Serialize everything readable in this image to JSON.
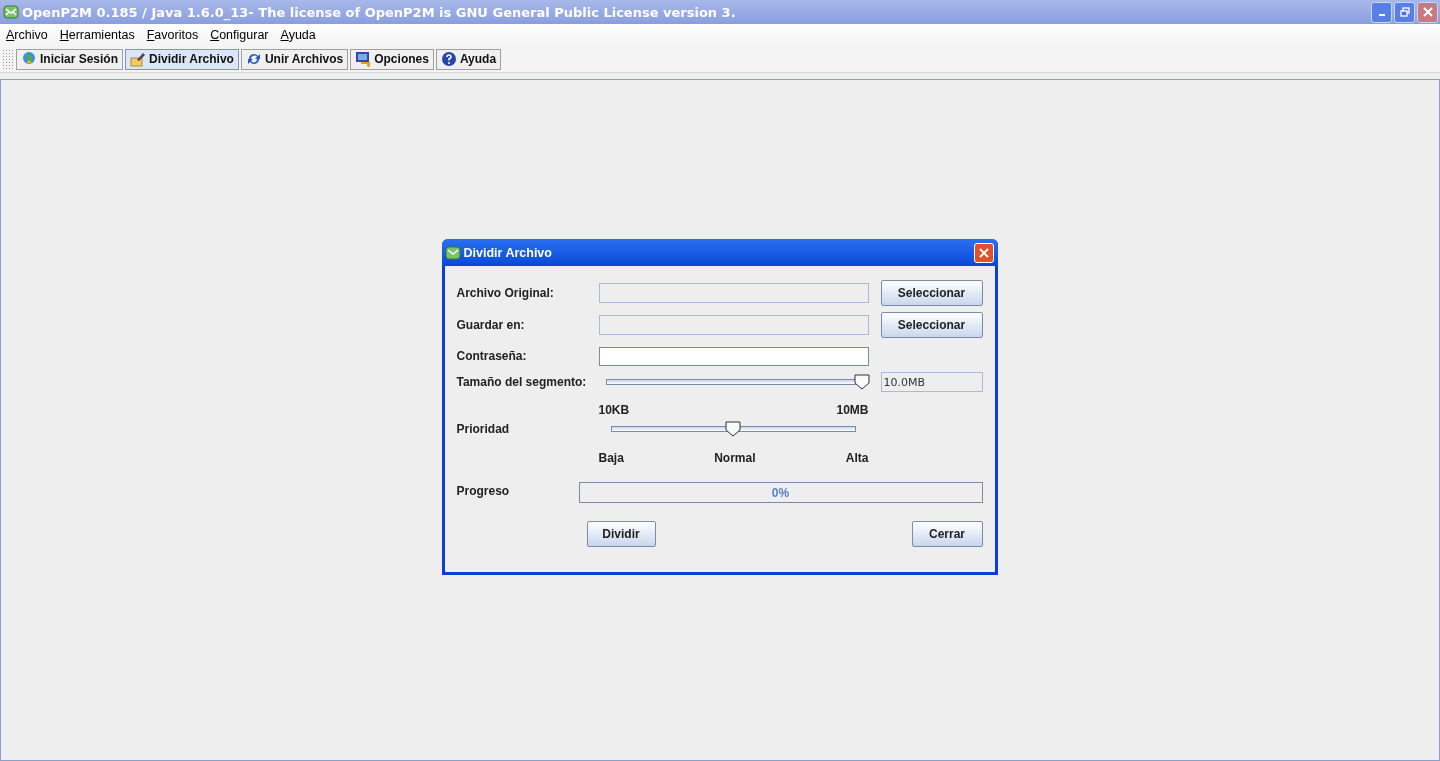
{
  "window": {
    "title": "OpenP2M 0.185 / Java 1.6.0_13- The license of OpenP2M is GNU General Public License version 3."
  },
  "menu": [
    "Archivo",
    "Herramientas",
    "Favoritos",
    "Configurar",
    "Ayuda"
  ],
  "toolbar": [
    {
      "label": "Iniciar Sesión",
      "kind": "globe",
      "selected": false
    },
    {
      "label": "Dividir Archivo",
      "kind": "split",
      "selected": true
    },
    {
      "label": "Unir Archivos",
      "kind": "sync",
      "selected": false
    },
    {
      "label": "Opciones",
      "kind": "options",
      "selected": false
    },
    {
      "label": "Ayuda",
      "kind": "help",
      "selected": false
    }
  ],
  "dialog": {
    "title": "Dividir Archivo",
    "original": {
      "label": "Archivo Original:",
      "disabled": true,
      "button": "Seleccionar"
    },
    "destination": {
      "label": "Guardar en:",
      "disabled": true,
      "button": "Seleccionar"
    },
    "password": {
      "label": "Contraseña:"
    },
    "segment": {
      "label": "Tamaño del segmento:",
      "level": 1,
      "reading": "10.0MB",
      "min_label": "10KB",
      "max_label": "10MB"
    },
    "priority": {
      "label": "Prioridad",
      "level": 0.5,
      "ticks": [
        "Baja",
        "Normal",
        "Alta"
      ]
    },
    "progress": {
      "label": "Progreso",
      "level": 0,
      "reading": "0%"
    },
    "buttons": [
      "Dividir",
      "Cerrar"
    ]
  }
}
